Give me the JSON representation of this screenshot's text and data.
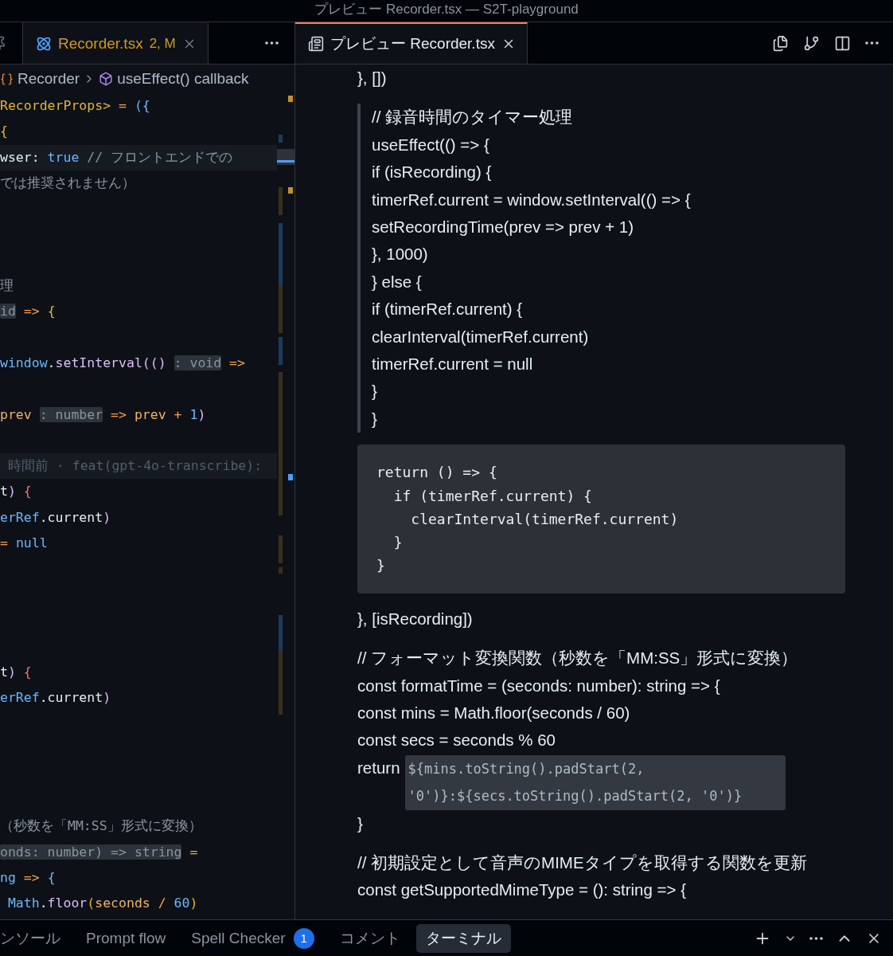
{
  "window": {
    "title": "プレビュー Recorder.tsx — S2T-playground"
  },
  "left_group": {
    "tabs": [
      {
        "label": "Recorder.tsx",
        "status": "2, M",
        "selected": true
      }
    ],
    "breadcrumb": [
      "Recorder",
      "useEffect() callback"
    ],
    "code_lines": [
      {
        "kind": "code",
        "segments": [
          {
            "t": "RecorderProps>",
            "kind": "type"
          },
          {
            "t": " = ",
            "kind": "op"
          },
          {
            "t": "({",
            "kind": "blue"
          }
        ]
      },
      {
        "kind": "code",
        "segments": [
          {
            "t": "{",
            "kind": "type"
          }
        ]
      },
      {
        "kind": "current",
        "segments": [
          {
            "t": "wser: ",
            "kind": "plain"
          },
          {
            "t": "true",
            "kind": "blue"
          },
          {
            "t": " // フロントエンドでの",
            "kind": "comment"
          }
        ]
      },
      {
        "kind": "code",
        "segments": [
          {
            "t": "では推奨されません）",
            "kind": "comment"
          }
        ]
      },
      {
        "kind": "blank"
      },
      {
        "kind": "blank"
      },
      {
        "kind": "blank"
      },
      {
        "kind": "code",
        "segments": [
          {
            "t": "理",
            "kind": "comment"
          }
        ]
      },
      {
        "kind": "code",
        "segments": [
          {
            "t": "id",
            "kind": "hint"
          },
          {
            "t": " => ",
            "kind": "op"
          },
          {
            "t": "{",
            "kind": "type"
          }
        ]
      },
      {
        "kind": "blank"
      },
      {
        "kind": "code",
        "segments": [
          {
            "t": "window",
            "kind": "blue"
          },
          {
            "t": ".",
            "kind": "plain"
          },
          {
            "t": "setInterval",
            "kind": "func"
          },
          {
            "t": "(() ",
            "kind": "func"
          },
          {
            "t": ": void",
            "kind": "hint"
          },
          {
            "t": " =>",
            "kind": "op"
          }
        ]
      },
      {
        "kind": "blank"
      },
      {
        "kind": "code",
        "segments": [
          {
            "t": "prev ",
            "kind": "param"
          },
          {
            "t": ": number",
            "kind": "hint"
          },
          {
            "t": " => ",
            "kind": "op"
          },
          {
            "t": "prev",
            "kind": "param"
          },
          {
            "t": " + ",
            "kind": "op"
          },
          {
            "t": "1",
            "kind": "blue"
          },
          {
            "t": ")",
            "kind": "func"
          }
        ]
      },
      {
        "kind": "blank"
      },
      {
        "kind": "blame",
        "segments": [
          {
            "t": " 時間前 · feat(gpt-4o-transcribe):",
            "kind": "blame"
          }
        ]
      },
      {
        "kind": "code",
        "segments": [
          {
            "t": "t",
            "kind": "plain"
          },
          {
            "t": ")",
            "kind": "func"
          },
          {
            "t": " {",
            "kind": "pink"
          }
        ]
      },
      {
        "kind": "code",
        "segments": [
          {
            "t": "erRef",
            "kind": "blue"
          },
          {
            "t": ".current",
            "kind": "plain"
          },
          {
            "t": ")",
            "kind": "func"
          }
        ]
      },
      {
        "kind": "code",
        "segments": [
          {
            "t": "= ",
            "kind": "op"
          },
          {
            "t": "null",
            "kind": "blue"
          }
        ]
      },
      {
        "kind": "blank"
      },
      {
        "kind": "blank"
      },
      {
        "kind": "blank"
      },
      {
        "kind": "blank"
      },
      {
        "kind": "code",
        "segments": [
          {
            "t": "t",
            "kind": "plain"
          },
          {
            "t": ")",
            "kind": "func"
          },
          {
            "t": " {",
            "kind": "pink"
          }
        ]
      },
      {
        "kind": "code",
        "segments": [
          {
            "t": "erRef",
            "kind": "blue"
          },
          {
            "t": ".current",
            "kind": "plain"
          },
          {
            "t": ")",
            "kind": "func"
          }
        ]
      },
      {
        "kind": "blank"
      },
      {
        "kind": "blank"
      },
      {
        "kind": "blank"
      },
      {
        "kind": "blank"
      },
      {
        "kind": "code",
        "segments": [
          {
            "t": "（秒数を「MM:SS」形式に変換）",
            "kind": "comment"
          }
        ]
      },
      {
        "kind": "code",
        "segments": [
          {
            "t": "onds: number) => string",
            "kind": "hint"
          },
          {
            "t": " =",
            "kind": "op"
          }
        ]
      },
      {
        "kind": "code",
        "segments": [
          {
            "t": "ng",
            "kind": "blue"
          },
          {
            "t": " => ",
            "kind": "op"
          },
          {
            "t": "{",
            "kind": "blue"
          }
        ]
      },
      {
        "kind": "code",
        "segments": [
          {
            "t": " Math",
            "kind": "blue"
          },
          {
            "t": ".",
            "kind": "plain"
          },
          {
            "t": "floor",
            "kind": "func"
          },
          {
            "t": "(",
            "kind": "type"
          },
          {
            "t": "seconds",
            "kind": "param"
          },
          {
            "t": " / ",
            "kind": "op"
          },
          {
            "t": "60",
            "kind": "blue"
          },
          {
            "t": ")",
            "kind": "type"
          }
        ]
      }
    ]
  },
  "right_group": {
    "tabs": [
      {
        "label": "プレビュー Recorder.tsx",
        "selected": true
      }
    ],
    "preview": [
      {
        "kind": "text",
        "lines": [
          {
            "text": "}, [])"
          }
        ]
      },
      {
        "kind": "quote",
        "lines": [
          {
            "text": "// 録音時間のタイマー処理"
          },
          {
            "text": "useEffect(() => {"
          },
          {
            "text": "if (isRecording) {"
          },
          {
            "text": "timerRef.current = window.setInterval(() => {"
          },
          {
            "text": "setRecordingTime(prev => prev + 1)"
          },
          {
            "text": "}, 1000)"
          },
          {
            "text": "} else {"
          },
          {
            "text": "if (timerRef.current) {"
          },
          {
            "text": "clearInterval(timerRef.current)"
          },
          {
            "text": "timerRef.current = null"
          },
          {
            "text": "}"
          },
          {
            "text": "}"
          }
        ]
      },
      {
        "kind": "code",
        "lines": [
          {
            "text": "return () => {"
          },
          {
            "text": "  if (timerRef.current) {"
          },
          {
            "text": "    clearInterval(timerRef.current)"
          },
          {
            "text": "  }"
          },
          {
            "text": "}"
          }
        ]
      },
      {
        "kind": "text",
        "lines": [
          {
            "text": "}, [isRecording])"
          }
        ]
      },
      {
        "kind": "text",
        "lines": [
          {
            "text": "// フォーマット変換関数（秒数を「MM:SS」形式に変換）"
          },
          {
            "text": "const formatTime = (seconds: number): string => {"
          },
          {
            "text": "const mins = Math.floor(seconds / 60)"
          },
          {
            "text": "const secs = seconds % 60"
          },
          {
            "text": "return",
            "code": "${mins.toString().padStart(2, '0')}:${secs.toString().padStart(2, '0')}"
          },
          {
            "text": "}"
          }
        ]
      },
      {
        "kind": "text",
        "lines": [
          {
            "text": "// 初期設定として音声のMIMEタイプを取得する関数を更新"
          },
          {
            "text": "const getSupportedMimeType = (): string => {"
          }
        ]
      }
    ]
  },
  "panel": {
    "tabs": [
      {
        "label": "ンソール",
        "selected": false
      },
      {
        "label": "Prompt flow",
        "selected": false
      },
      {
        "label": "Spell Checker",
        "badge": "1",
        "selected": false
      },
      {
        "label": "コメント",
        "selected": false
      },
      {
        "label": "ターミナル",
        "selected": true
      }
    ]
  }
}
